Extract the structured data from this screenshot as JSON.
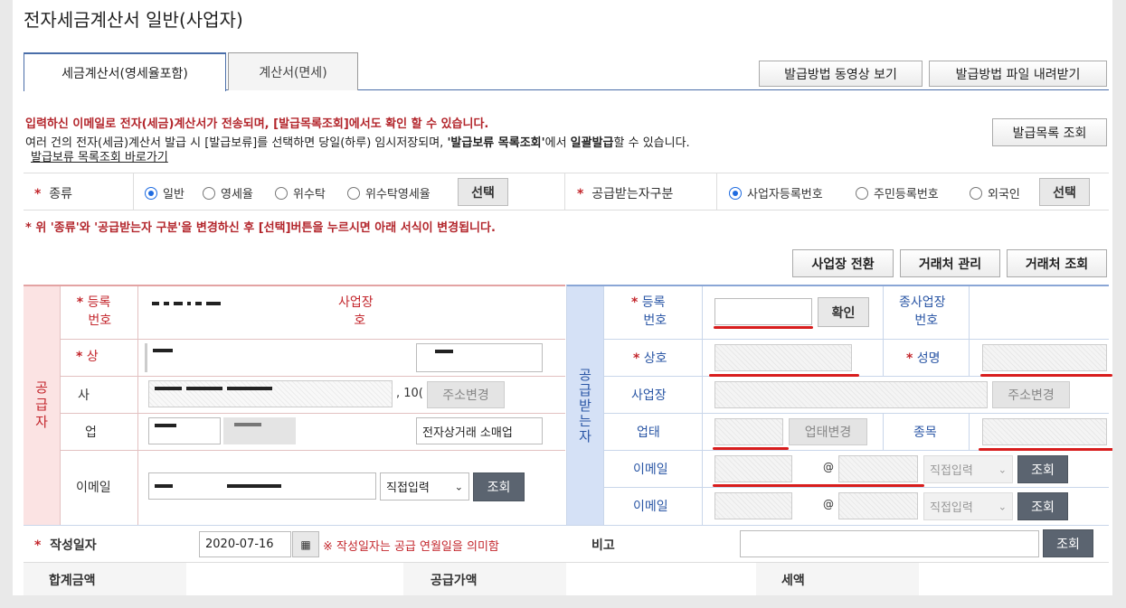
{
  "title": "전자세금계산서 일반(사업자)",
  "tabs": [
    {
      "label": "세금계산서(영세율포함)",
      "active": true
    },
    {
      "label": "계산서(면세)",
      "active": false
    }
  ],
  "top_buttons": {
    "video": "발급방법 동영상 보기",
    "download": "발급방법 파일 내려받기"
  },
  "notice": {
    "line1": "입력하신 이메일로 전자(세금)계산서가 전송되며, [발급목록조회]에서도 확인 할 수 있습니다.",
    "line2_a": "여러 건의 전자(세금)계산서 발급 시 [발급보류]를 선택하면 당일(하루) 임시저장되며, ",
    "line2_b": "'발급보류 목록조회'",
    "line2_c": "에서 ",
    "line2_d": "일괄발급",
    "line2_e": "할 수 있습니다.",
    "link": "발급보류 목록조회 바로가기",
    "list_button": "발급목록 조회"
  },
  "type_row": {
    "label": "종류",
    "options": [
      "일반",
      "영세율",
      "위수탁",
      "위수탁영세율"
    ],
    "selected": "일반",
    "select_button": "선택",
    "receiver_label": "공급받는자구분",
    "receiver_options": [
      "사업자등록번호",
      "주민등록번호",
      "외국인"
    ],
    "receiver_selected": "사업자등록번호",
    "receiver_button": "선택"
  },
  "warning": "* 위 '종류'와 '공급받는자 구분'을 변경하신 후 [선택]버튼을 누르시면 아래 서식이 변경됩니다.",
  "action_buttons": {
    "switch": "사업장 전환",
    "manage": "거래처 관리",
    "search": "거래처 조회"
  },
  "supplier": {
    "section_label": "공급자",
    "reg_label_1": "등록",
    "reg_label_2": "번호",
    "sub_label_1": "사업장",
    "sub_label_2": "호",
    "name_label": "상",
    "addr_label": "사",
    "addr_suffix": ", 10(",
    "addr_button": "주소변경",
    "type_label": "업",
    "item_value": "전자상거래 소매업",
    "email_label": "이메일",
    "email_select": "직접입력",
    "email_button": "조회"
  },
  "receiver": {
    "section_label": "공급받는자",
    "reg_label_1": "등록",
    "reg_label_2": "번호",
    "confirm_button": "확인",
    "sub_label_1": "종사업장",
    "sub_label_2": "번호",
    "name_label": "상호",
    "ceo_label": "성명",
    "addr_label": "사업장",
    "addr_button": "주소변경",
    "type_label": "업태",
    "type_button": "업태변경",
    "item_label": "종목",
    "email_label": "이메일",
    "email2_label": "이메일",
    "at": "@",
    "email_select": "직접입력",
    "email_button": "조회"
  },
  "date_row": {
    "label": "작성일자",
    "value": "2020-07-16",
    "note": "※ 작성일자는 공급 연월일을 의미함",
    "memo_label": "비고",
    "memo_button": "조회"
  },
  "totals": {
    "total": "합계금액",
    "supply": "공급가액",
    "tax": "세액"
  },
  "colors": {
    "accent_red": "#c3262c",
    "supplier_bg": "#fbe3e3",
    "receiver_bg": "#d5e1f6",
    "dark_button": "#5b6470"
  }
}
